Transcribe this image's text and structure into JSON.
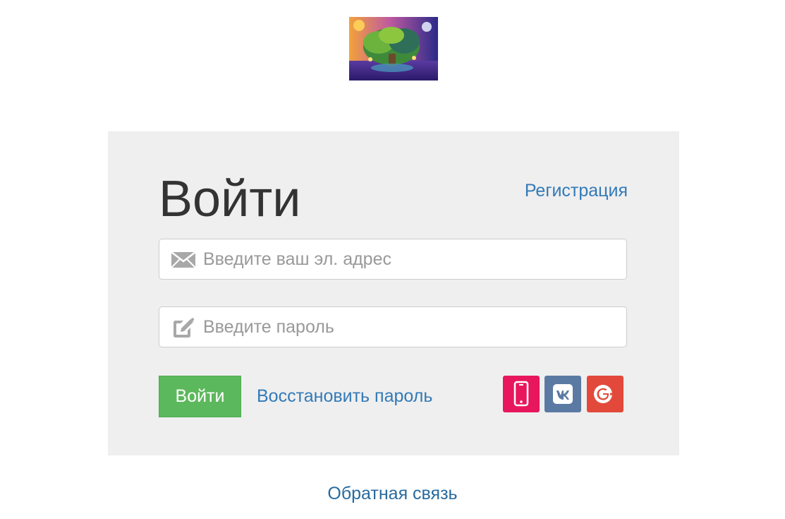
{
  "logo": {
    "icon": "tree-of-life-logo"
  },
  "login_form": {
    "title": "Войти",
    "register_link": "Регистрация",
    "email": {
      "placeholder": "Введите ваш эл. адрес",
      "value": "",
      "icon": "envelope-icon"
    },
    "password": {
      "placeholder": "Введите пароль",
      "value": "",
      "icon": "edit-icon"
    },
    "login_button": "Войти",
    "restore_link": "Восстановить пароль",
    "social": [
      {
        "name": "phone",
        "icon": "smartphone-icon",
        "color": "#e8175d"
      },
      {
        "name": "vk",
        "icon": "vk-icon",
        "color": "#5b7aa3"
      },
      {
        "name": "google-plus",
        "icon": "google-plus-icon",
        "color": "#e2493a"
      }
    ]
  },
  "footer": {
    "feedback_link": "Обратная связь"
  },
  "colors": {
    "card_background": "#efefef",
    "link": "#337ab7",
    "button": "#5cb85c",
    "title": "#333333"
  }
}
